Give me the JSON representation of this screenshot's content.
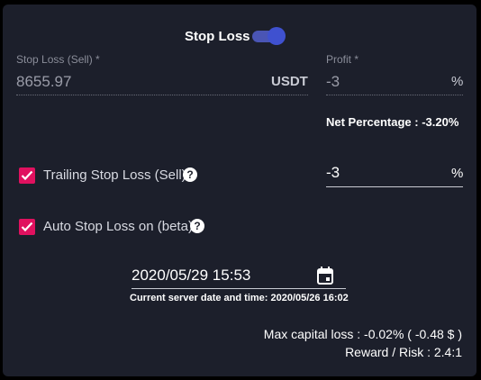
{
  "stop_loss_toggle": {
    "label": "Stop Loss",
    "enabled": true
  },
  "stop_loss_sell": {
    "label": "Stop Loss (Sell) *",
    "value": "8655.97",
    "unit": "USDT"
  },
  "profit": {
    "label": "Profit *",
    "value": "-3",
    "unit": "%"
  },
  "net_percentage": "Net Percentage : -3.20%",
  "trailing": {
    "label": "Trailing Stop Loss (Sell)",
    "checked": true,
    "value": "-3",
    "unit": "%",
    "help": "?"
  },
  "auto_stop": {
    "label": "Auto Stop Loss on (beta)",
    "checked": true,
    "help": "?"
  },
  "date": {
    "value": "2020/05/29 15:53",
    "server_text": "Current server date and time: 2020/05/26 16:02"
  },
  "summary": {
    "max_capital_loss": "Max capital loss : -0.02% ( -0.48 $ )",
    "reward_risk": "Reward / Risk : 2.4:1"
  },
  "colors": {
    "accent": "#3f51d0",
    "checkbox": "#e0115f",
    "panel": "#1c1f2b"
  }
}
